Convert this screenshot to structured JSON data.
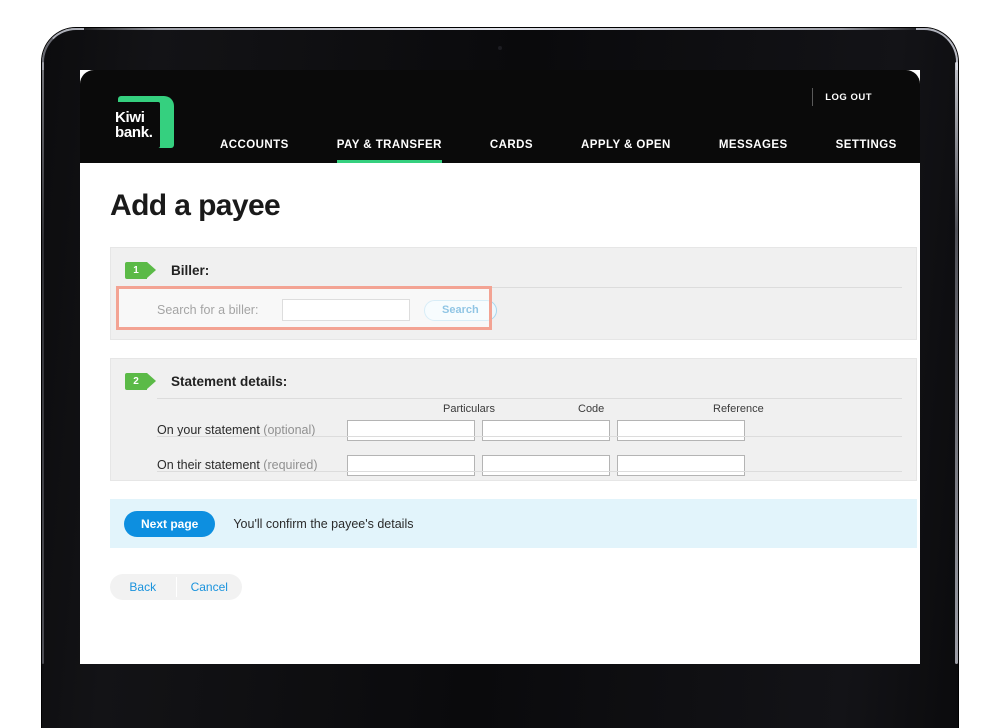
{
  "device": {
    "type": "tablet"
  },
  "header": {
    "logo": {
      "line1": "Kiwi",
      "line2": "bank.",
      "accent": "#35d07f"
    },
    "logout_label": "LOG OUT",
    "nav": [
      {
        "label": "ACCOUNTS",
        "active": false
      },
      {
        "label": "PAY & TRANSFER",
        "active": true
      },
      {
        "label": "CARDS",
        "active": false
      },
      {
        "label": "APPLY & OPEN",
        "active": false
      },
      {
        "label": "MESSAGES",
        "active": false
      },
      {
        "label": "SETTINGS",
        "active": false
      }
    ]
  },
  "page": {
    "title": "Add a payee"
  },
  "biller_section": {
    "step_number": "1",
    "title": "Biller:",
    "search_label": "Search for a biller:",
    "search_value": "",
    "search_placeholder": "",
    "search_button": "Search",
    "highlight_color": "#f3a393"
  },
  "statement_section": {
    "step_number": "2",
    "title": "Statement details:",
    "columns": [
      "Particulars",
      "Code",
      "Reference"
    ],
    "rows": [
      {
        "label": "On your statement",
        "qualifier": " (optional)",
        "values": [
          "",
          "",
          ""
        ]
      },
      {
        "label": "On their statement",
        "qualifier": " (required)",
        "values": [
          "",
          "",
          ""
        ]
      }
    ]
  },
  "next_strip": {
    "button_label": "Next page",
    "note": "You'll confirm the payee's details",
    "background": "#e2f4fb",
    "button_color": "#0d8fe0"
  },
  "bottom_actions": {
    "back_label": "Back",
    "cancel_label": "Cancel"
  }
}
